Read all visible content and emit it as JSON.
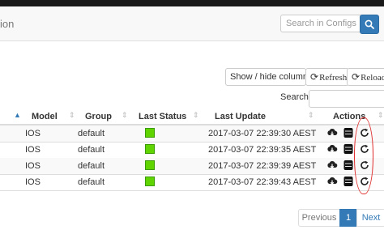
{
  "navbar": {
    "title_fragment": "ion",
    "search_placeholder": "Search in Configs"
  },
  "toolbar": {
    "columns_label": "Show / hide columns",
    "refresh_label": "Refresh",
    "reload_label": "Reload"
  },
  "table": {
    "search_label": "Search:",
    "columns": [
      "Model",
      "Group",
      "Last Status",
      "Last Update",
      "Actions"
    ],
    "rows": [
      {
        "model": "IOS",
        "group": "default",
        "status_color": "#5fd400",
        "last_update": "2017-03-07 22:39:30 AEST"
      },
      {
        "model": "IOS",
        "group": "default",
        "status_color": "#5fd400",
        "last_update": "2017-03-07 22:39:35 AEST"
      },
      {
        "model": "IOS",
        "group": "default",
        "status_color": "#5fd400",
        "last_update": "2017-03-07 22:39:39 AEST"
      },
      {
        "model": "IOS",
        "group": "default",
        "status_color": "#5fd400",
        "last_update": "2017-03-07 22:39:43 AEST"
      }
    ],
    "action_icons": [
      "cloud-download-icon",
      "database-icon",
      "refresh-icon"
    ]
  },
  "pagination": {
    "previous_label": "Previous",
    "current_page": "1",
    "next_label": "Next"
  },
  "colors": {
    "primary": "#337ab7",
    "status_ok": "#5fd400",
    "annotation": "#e03030"
  }
}
